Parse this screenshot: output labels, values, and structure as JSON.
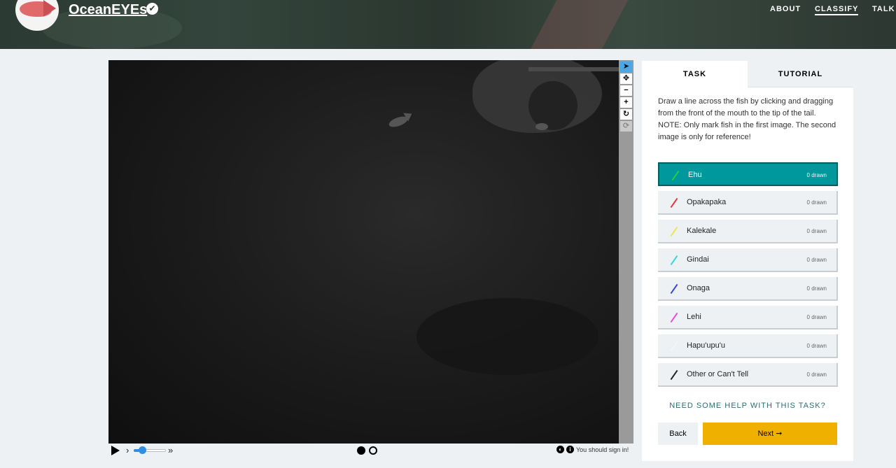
{
  "header": {
    "brand": "OceanEYEs",
    "verified_icon": "check-circle-icon",
    "nav": [
      {
        "label": "ABOUT",
        "active": false
      },
      {
        "label": "CLASSIFY",
        "active": true
      },
      {
        "label": "TALK",
        "active": false
      }
    ]
  },
  "viewer": {
    "tools": [
      {
        "icon": "pointer-icon",
        "glyph": "➤",
        "state": "selected"
      },
      {
        "icon": "move-icon",
        "glyph": "✥",
        "state": "normal"
      },
      {
        "icon": "zoom-out-icon",
        "glyph": "−",
        "state": "normal"
      },
      {
        "icon": "zoom-in-icon",
        "glyph": "+",
        "state": "normal"
      },
      {
        "icon": "rotate-icon",
        "glyph": "↻",
        "state": "normal"
      },
      {
        "icon": "reset-icon",
        "glyph": "⟳",
        "state": "disabled"
      }
    ],
    "controls": {
      "play_icon": "play-icon",
      "slow_icon": "›",
      "fast_icon": "»",
      "speed_level": 0.25,
      "frames": [
        {
          "active": true
        },
        {
          "active": false
        }
      ],
      "signin_text": "You should sign in!"
    }
  },
  "panel": {
    "tabs": {
      "task": "TASK",
      "tutorial": "TUTORIAL"
    },
    "instructions": "Draw a line across the fish by clicking and dragging from the front of the mouth to the tip of the tail.",
    "note": "NOTE: Only mark fish in the first image. The second image is only for reference!",
    "choices": [
      {
        "label": "Ehu",
        "count": "0 drawn",
        "color": "#1bd34a",
        "selected": true
      },
      {
        "label": "Opakapaka",
        "count": "0 drawn",
        "color": "#e8353b",
        "selected": false
      },
      {
        "label": "Kalekale",
        "count": "0 drawn",
        "color": "#f0e54a",
        "selected": false
      },
      {
        "label": "Gindai",
        "count": "0 drawn",
        "color": "#35d6e0",
        "selected": false
      },
      {
        "label": "Onaga",
        "count": "0 drawn",
        "color": "#3048d8",
        "selected": false
      },
      {
        "label": "Lehi",
        "count": "0 drawn",
        "color": "#e84ad8",
        "selected": false
      },
      {
        "label": "Hapu'upu'u",
        "count": "0 drawn",
        "color": "#f4f4f4",
        "selected": false
      },
      {
        "label": "Other or Can't Tell",
        "count": "0 drawn",
        "color": "#222222",
        "selected": false
      }
    ],
    "help_link": "NEED SOME HELP WITH THIS TASK?",
    "back_label": "Back",
    "next_label": "Next ➞"
  }
}
